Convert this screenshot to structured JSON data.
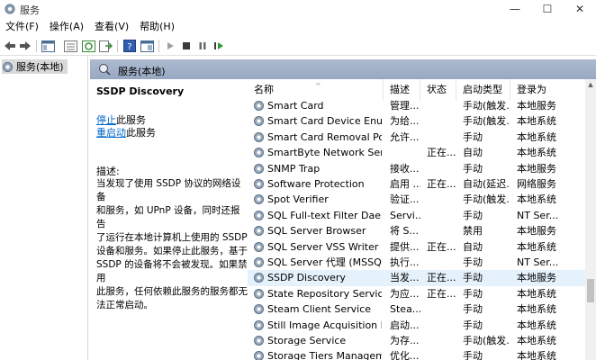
{
  "window": {
    "title": "服务"
  },
  "menu": [
    "文件(F)",
    "操作(A)",
    "查看(V)",
    "帮助(H)"
  ],
  "tree": {
    "item": "服务(本地)"
  },
  "panel_header": "服务(本地)",
  "desc": {
    "title": "SSDP Discovery",
    "stop_link": "停止",
    "stop_rest": "此服务",
    "restart_link": "重启动",
    "restart_rest": "此服务",
    "label": "描述:",
    "lines": [
      "当发现了使用 SSDP 协议的网络设备",
      "和服务，如 UPnP 设备，同时还报告",
      "了运行在本地计算机上使用的 SSDP",
      "设备和服务。如果停止此服务，基于",
      "SSDP 的设备将不会被发现。如果禁用",
      "此服务，任何依赖此服务的服务都无",
      "法正常启动。"
    ]
  },
  "columns": [
    "名称",
    "描述",
    "状态",
    "启动类型",
    "登录为"
  ],
  "rows": [
    {
      "name": "Smart Card",
      "desc": "管理...",
      "status": "",
      "startup": "手动(触发...",
      "logon": "本地服务"
    },
    {
      "name": "Smart Card Device Enumer...",
      "desc": "为给...",
      "status": "",
      "startup": "手动(触发...",
      "logon": "本地系统"
    },
    {
      "name": "Smart Card Removal Policy",
      "desc": "允许...",
      "status": "",
      "startup": "手动",
      "logon": "本地系统"
    },
    {
      "name": "SmartByte Network Service",
      "desc": "",
      "status": "正在...",
      "startup": "自动",
      "logon": "本地系统"
    },
    {
      "name": "SNMP Trap",
      "desc": "接收...",
      "status": "",
      "startup": "手动",
      "logon": "本地服务"
    },
    {
      "name": "Software Protection",
      "desc": "启用 ...",
      "status": "正在...",
      "startup": "自动(延迟...",
      "logon": "网络服务"
    },
    {
      "name": "Spot Verifier",
      "desc": "验证...",
      "status": "",
      "startup": "手动(触发...",
      "logon": "本地系统"
    },
    {
      "name": "SQL Full-text Filter Daemo...",
      "desc": "Servi...",
      "status": "",
      "startup": "手动",
      "logon": "NT Ser..."
    },
    {
      "name": "SQL Server Browser",
      "desc": "将 S...",
      "status": "",
      "startup": "禁用",
      "logon": "本地服务"
    },
    {
      "name": "SQL Server VSS Writer",
      "desc": "提供...",
      "status": "正在...",
      "startup": "自动",
      "logon": "本地系统"
    },
    {
      "name": "SQL Server 代理 (MSSQLS...",
      "desc": "执行...",
      "status": "",
      "startup": "手动",
      "logon": "NT Ser..."
    },
    {
      "name": "SSDP Discovery",
      "desc": "当发...",
      "status": "正在...",
      "startup": "手动",
      "logon": "本地服务",
      "selected": true
    },
    {
      "name": "State Repository Service",
      "desc": "为应...",
      "status": "正在...",
      "startup": "手动",
      "logon": "本地系统"
    },
    {
      "name": "Steam Client Service",
      "desc": "Stea...",
      "status": "",
      "startup": "手动",
      "logon": "本地系统"
    },
    {
      "name": "Still Image Acquisition Eve...",
      "desc": "启动...",
      "status": "",
      "startup": "手动",
      "logon": "本地系统"
    },
    {
      "name": "Storage Service",
      "desc": "为存...",
      "status": "",
      "startup": "手动(触发...",
      "logon": "本地系统"
    },
    {
      "name": "Storage Tiers Management",
      "desc": "优化...",
      "status": "",
      "startup": "手动",
      "logon": "本地系统"
    }
  ],
  "icons": {
    "title": "gear-icon",
    "back": "back-arrow-icon",
    "forward": "forward-arrow-icon",
    "play": "play-icon",
    "stop": "stop-icon",
    "pause": "pause-icon",
    "restart": "restart-icon"
  },
  "colors": {
    "selection": "#e5f1fb",
    "header": "#a3b2ca",
    "link": "#0066cc"
  }
}
